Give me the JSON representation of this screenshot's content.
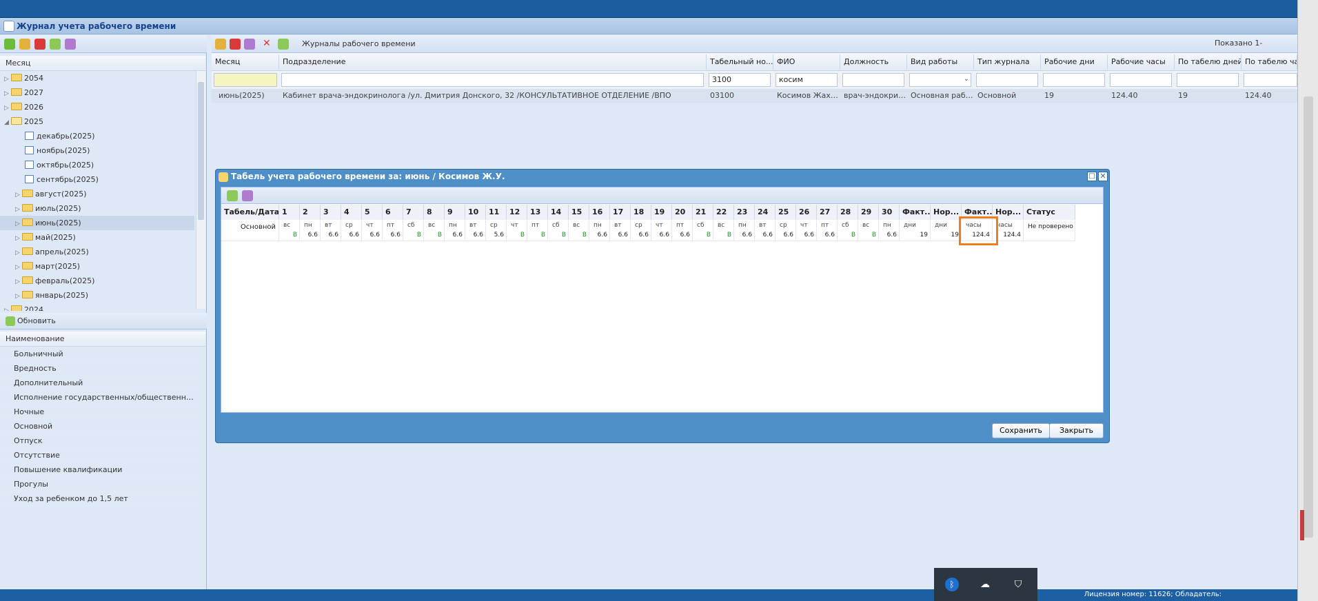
{
  "app": {
    "journal_title": "Журнал учета рабочего времени",
    "refresh_label": "Обновить",
    "license": "Лицензия номер: 11626; Обладатель:"
  },
  "left": {
    "month_header": "Месяц",
    "tree": [
      {
        "label": "2054"
      },
      {
        "label": "2027"
      },
      {
        "label": "2026"
      },
      {
        "label": "2025"
      },
      {
        "label": "декабрь(2025)"
      },
      {
        "label": "ноябрь(2025)"
      },
      {
        "label": "октябрь(2025)"
      },
      {
        "label": "сентябрь(2025)"
      },
      {
        "label": "август(2025)"
      },
      {
        "label": "июль(2025)"
      },
      {
        "label": "июнь(2025)"
      },
      {
        "label": "май(2025)"
      },
      {
        "label": "апрель(2025)"
      },
      {
        "label": "март(2025)"
      },
      {
        "label": "февраль(2025)"
      },
      {
        "label": "январь(2025)"
      },
      {
        "label": "2024"
      }
    ],
    "name_header": "Наименование",
    "names": [
      "Больничный",
      "Вредность",
      "Дополнительный",
      "Исполнение государственных/общественных об...",
      "Ночные",
      "Основной",
      "Отпуск",
      "Отсутствие",
      "Повышение квалификации",
      "Прогулы",
      "Уход за ребенком до 1,5 лет"
    ]
  },
  "main": {
    "toolbar_label": "Журналы рабочего времени",
    "shown": "Показано 1-",
    "columns": [
      "Месяц",
      "Подразделение",
      "Табельный но...",
      "ФИО",
      "Должность",
      "Вид работы",
      "Тип журнала",
      "Рабочие дни",
      "Рабочие часы",
      "По табелю дней",
      "По табелю час"
    ],
    "filters": {
      "tabel": "3100",
      "fio": "косим"
    },
    "row": [
      "июнь(2025)",
      "Кабинет врача-эндокринолога /ул. Дмитрия Донского, 32 /КОНСУЛЬТАТИВНОЕ ОТДЕЛЕНИЕ /ВПО",
      "03100",
      "Косимов Жахо...",
      "врач-эндокрин...",
      "Основная работа",
      "Основной",
      "19",
      "124.40",
      "19",
      "124.40"
    ]
  },
  "dialog": {
    "title": "Табель учета рабочего времени за: июнь / Косимов Ж.У.",
    "headers": [
      "Табель/Дата",
      "1",
      "2",
      "3",
      "4",
      "5",
      "6",
      "7",
      "8",
      "9",
      "10",
      "11",
      "12",
      "13",
      "14",
      "15",
      "16",
      "17",
      "18",
      "19",
      "20",
      "21",
      "22",
      "23",
      "24",
      "25",
      "26",
      "27",
      "28",
      "29",
      "30",
      "Факт...",
      "Нор...",
      "Факт...",
      "Нор...",
      "Статус"
    ],
    "row_label": "Основной",
    "weekdays": [
      "вс",
      "пн",
      "вт",
      "ср",
      "чт",
      "пт",
      "сб",
      "вс",
      "пн",
      "вт",
      "ср",
      "чт",
      "пт",
      "сб",
      "вс",
      "пн",
      "вт",
      "ср",
      "чт",
      "пт",
      "сб",
      "вс",
      "пн",
      "вт",
      "ср",
      "чт",
      "пт",
      "сб",
      "вс",
      "пн"
    ],
    "values": [
      "В",
      "6.6",
      "6.6",
      "6.6",
      "6.6",
      "6.6",
      "В",
      "В",
      "6.6",
      "6.6",
      "5.6",
      "В",
      "В",
      "В",
      "В",
      "6.6",
      "6.6",
      "6.6",
      "6.6",
      "6.6",
      "В",
      "В",
      "6.6",
      "6.6",
      "6.6",
      "6.6",
      "6.6",
      "В",
      "В",
      "6.6"
    ],
    "totals": [
      {
        "unit": "дни",
        "value": "19"
      },
      {
        "unit": "дни",
        "value": "19"
      },
      {
        "unit": "часы",
        "value": "124.4"
      },
      {
        "unit": "часы",
        "value": "124.4"
      }
    ],
    "status": "Не проверено",
    "save_label": "Сохранить",
    "close_label": "Закрыть",
    "highlight_color": "#f07d1a",
    "weekend_color": "#1b8f1b"
  }
}
